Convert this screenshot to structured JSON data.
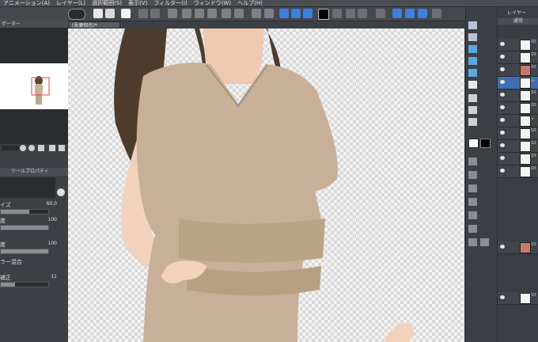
{
  "menubar": {
    "items": [
      "アニメーション(A)",
      "レイヤー(L)",
      "選択範囲(S)",
      "表示(V)",
      "フィルター(I)",
      "ウィンドウ(W)",
      "ヘルプ(H)"
    ]
  },
  "document": {
    "tab_title": "(吾妻郁也)*"
  },
  "left_panel": {
    "navigator_title": "ゲーター",
    "tool_property_title": "ツールプロパティ",
    "properties": [
      {
        "label": "イズ",
        "value": "60.0"
      },
      {
        "label": "度",
        "value": "100"
      },
      {
        "label": "度",
        "value": "100"
      },
      {
        "label": "ラー混合",
        "value": ""
      },
      {
        "label": "補正",
        "value": "11"
      }
    ],
    "progress": [
      0.6,
      1.0,
      1.0,
      0.0,
      0.3
    ]
  },
  "right_panel": {
    "tab_label": "レイヤー",
    "blend_mode": "通常",
    "layer_labels": [
      "10",
      "10",
      "10",
      "レ",
      "10",
      "10",
      "レ",
      "10",
      "10",
      "10",
      "10",
      "10",
      "10"
    ]
  },
  "colors": {
    "ui_bg": "#3c3f44",
    "canvas_checker": "#dadada",
    "shirt": "#c7b097",
    "skin": "#f3d2bd",
    "hair": "#4d3b2e",
    "main_color": "#000000"
  },
  "icons": [
    "new-file-icon",
    "open-folder-icon",
    "save-icon",
    "undo-icon",
    "redo-icon",
    "transform-icon",
    "color-swatch-icon",
    "brush-icon",
    "pen-icon",
    "eraser-icon",
    "fill-icon",
    "gradient-icon",
    "eyedropper-icon",
    "text-icon",
    "layer-visible-icon"
  ]
}
